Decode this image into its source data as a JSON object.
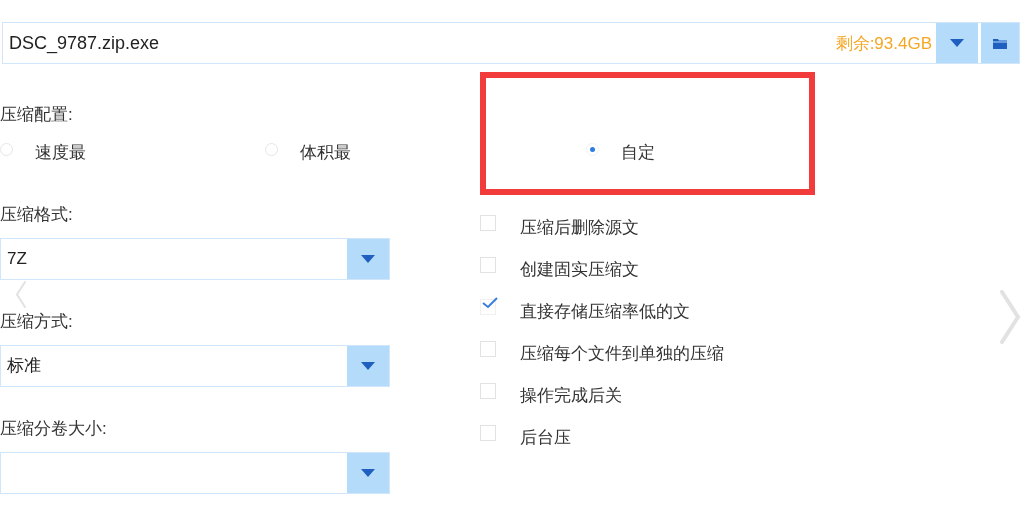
{
  "path_bar": {
    "value": "DSC_9787.zip.exe",
    "free_space": "剩余:93.4GB"
  },
  "compression_profile": {
    "label": "压缩配置:",
    "options": [
      {
        "label": "速度最",
        "selected": false
      },
      {
        "label": "体积最",
        "selected": false
      },
      {
        "label": "自定",
        "selected": true
      }
    ]
  },
  "fields": [
    {
      "label": "压缩格式:",
      "value": "7Z"
    },
    {
      "label": "压缩方式:",
      "value": "标准"
    },
    {
      "label": "压缩分卷大小:"
    }
  ],
  "options": [
    {
      "label": "压缩后删除源文",
      "checked": false
    },
    {
      "label": "创建固实压缩文",
      "checked": false
    },
    {
      "label": "直接存储压缩率低的文",
      "checked": true
    },
    {
      "label": "压缩每个文件到单独的压缩",
      "checked": false
    },
    {
      "label": "操作完成后关",
      "checked": false
    },
    {
      "label": "后台压",
      "checked": false
    }
  ]
}
